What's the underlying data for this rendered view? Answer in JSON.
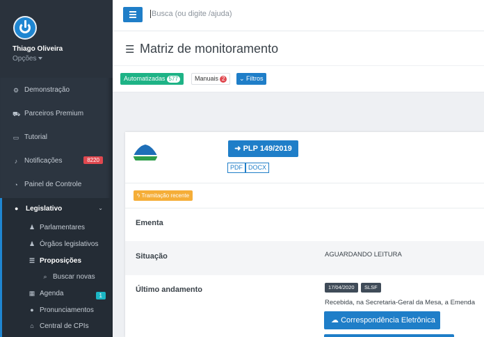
{
  "user": {
    "name": "Thiago Oliveira",
    "options_label": "Opções"
  },
  "sidebar": {
    "items": [
      {
        "label": "Demonstração",
        "icon": "gear-icon"
      },
      {
        "label": "Parceiros Premium",
        "icon": "cart-icon"
      },
      {
        "label": "Tutorial",
        "icon": "monitor-icon"
      },
      {
        "label": "Notificações",
        "icon": "bell-icon",
        "badge": "8220"
      },
      {
        "label": "Painel de Controle",
        "icon": "dashboard-icon"
      }
    ],
    "legislativo": {
      "label": "Legislativo",
      "subitems": [
        {
          "label": "Parlamentares",
          "icon": "user-icon"
        },
        {
          "label": "Órgãos legislativos",
          "icon": "users-icon"
        },
        {
          "label": "Proposições",
          "icon": "list-icon"
        },
        {
          "label": "Buscar novas",
          "icon": "search-icon"
        },
        {
          "label": "Agenda",
          "icon": "calendar-icon",
          "badge": "1"
        },
        {
          "label": "Pronunciamentos",
          "icon": "comment-icon"
        },
        {
          "label": "Central de CPIs",
          "icon": "building-icon"
        }
      ]
    }
  },
  "topbar": {
    "search_placeholder": "Busca (ou digite /ajuda)"
  },
  "page": {
    "title": "Matriz de monitoramento"
  },
  "filters": {
    "auto_label": "Automatizadas",
    "auto_count": "577",
    "manual_label": "Manuais",
    "manual_count": "2",
    "filters_label": "Filtros"
  },
  "card": {
    "plp_label": "PLP 149/2019",
    "pdf_label": "PDF",
    "docx_label": "DOCX",
    "tramitacao_label": "Tramitação recente",
    "ementa_label": "Ementa",
    "situacao_label": "Situação",
    "situacao_value": "AGUARDANDO LEITURA",
    "ultimo_label": "Último andamento",
    "andamento_date": "17/04/2020",
    "andamento_org": "SLSF",
    "andamento_text": "Recebida, na Secretaria-Geral da Mesa, a Emenda",
    "corr_label": "Correspondência Eletrônica"
  },
  "colors": {
    "primary": "#1f7ec8",
    "success": "#1eb386",
    "danger": "#e0484f",
    "warning": "#f5a623",
    "sidebar": "#2c3540"
  }
}
